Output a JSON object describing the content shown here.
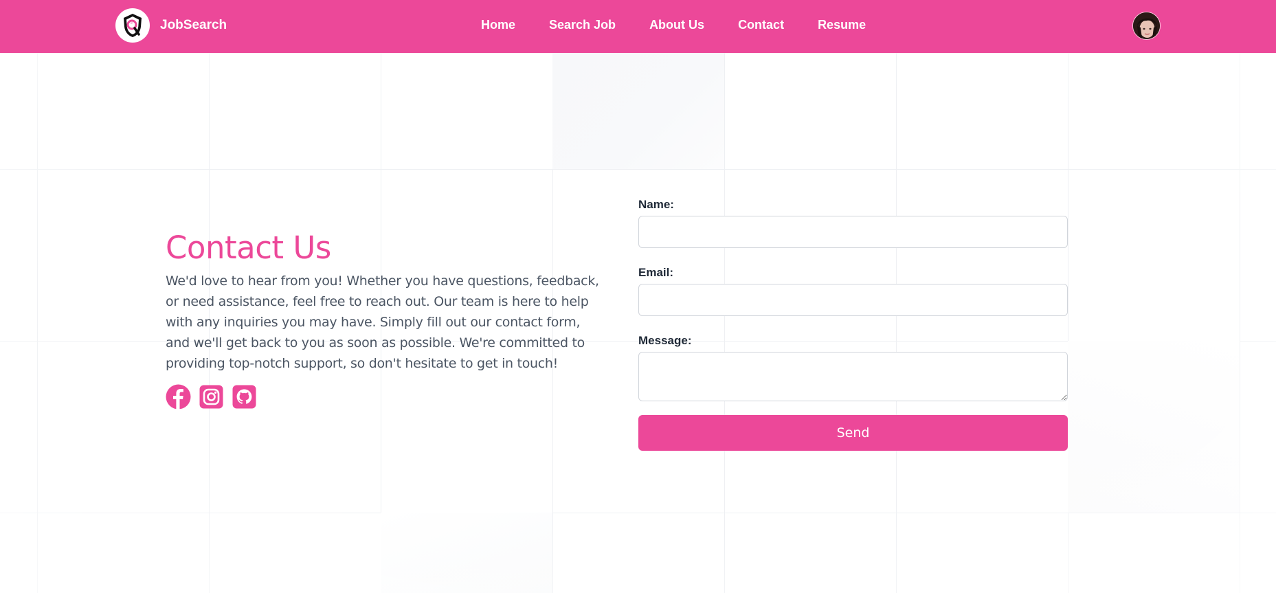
{
  "header": {
    "brand_name": "JobSearch",
    "nav": [
      "Home",
      "Search Job",
      "About Us",
      "Contact",
      "Resume"
    ]
  },
  "contact": {
    "title": "Contact Us",
    "description": "We'd love to hear from you! Whether you have questions, feedback, or need assistance, feel free to reach out. Our team is here to help with any inquiries you may have. Simply fill out our contact form, and we'll get back to you as soon as possible. We're committed to providing top-notch support, so don't hesitate to get in touch!",
    "socials": [
      "facebook-icon",
      "instagram-icon",
      "github-icon"
    ]
  },
  "form": {
    "name_label": "Name:",
    "name_value": "",
    "email_label": "Email:",
    "email_value": "",
    "message_label": "Message:",
    "message_value": "",
    "send_label": "Send"
  },
  "colors": {
    "accent": "#ec4899",
    "text": "#4b5563",
    "border": "#d1d5db"
  }
}
